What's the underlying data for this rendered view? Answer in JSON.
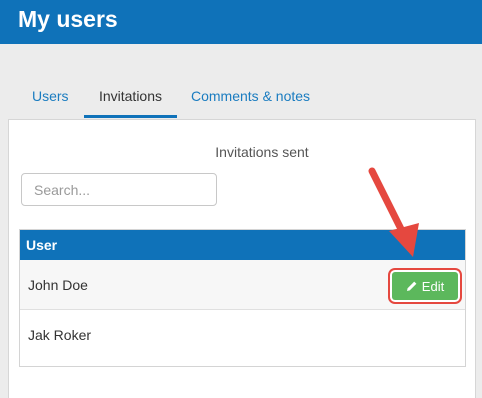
{
  "header": {
    "title": "My users"
  },
  "tabs": [
    {
      "label": "Users",
      "active": false
    },
    {
      "label": "Invitations",
      "active": true
    },
    {
      "label": "Comments & notes",
      "active": false
    }
  ],
  "panel": {
    "caption": "Invitations sent",
    "search": {
      "placeholder": "Search...",
      "value": ""
    }
  },
  "table": {
    "columns": [
      "User"
    ],
    "rows": [
      {
        "name": "John Doe",
        "action": "Edit"
      },
      {
        "name": "Jak Roker"
      }
    ]
  },
  "colors": {
    "header": "#0f72b9",
    "edit_button": "#5cb85c",
    "highlight": "#e5483f"
  },
  "icons": {
    "edit": "pencil-icon",
    "annotation": "red-arrow-icon"
  }
}
